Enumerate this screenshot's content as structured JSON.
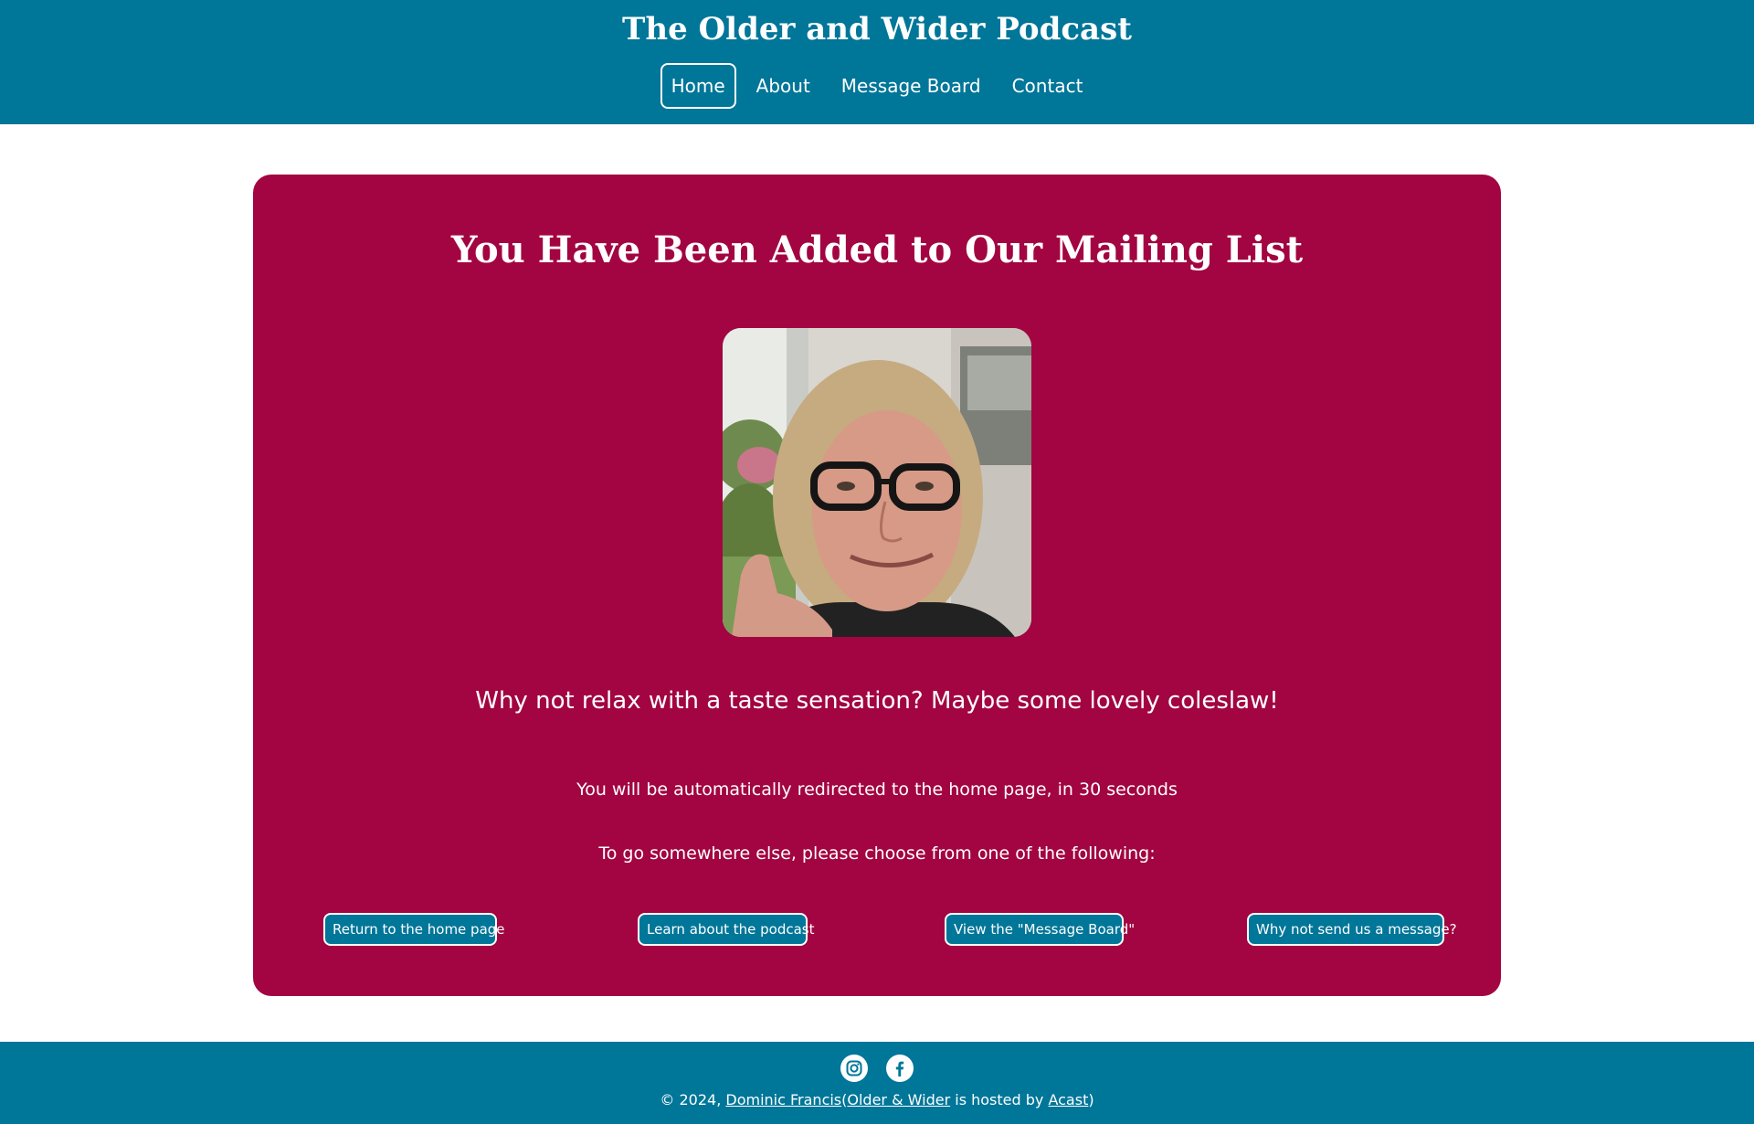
{
  "header": {
    "title": "The Older and Wider Podcast",
    "nav": [
      {
        "label": "Home",
        "active": true
      },
      {
        "label": "About"
      },
      {
        "label": "Message Board"
      },
      {
        "label": "Contact"
      }
    ]
  },
  "main": {
    "heading": "You Have Been Added to Our Mailing List",
    "tagline": "Why not relax with a taste sensation? Maybe some lovely coleslaw!",
    "redirect_text": "You will be automatically redirected to the home page, in 30 seconds",
    "choose_text": "To go somewhere else, please choose from one of the following:",
    "buttons": [
      {
        "label": "Return to the home page"
      },
      {
        "label": "Learn about the podcast"
      },
      {
        "label": "View the \"Message Board\""
      },
      {
        "label": "Why not send us a message?"
      }
    ]
  },
  "footer": {
    "icons": [
      "instagram-icon",
      "facebook-icon"
    ],
    "copyright_prefix": "© 2024,",
    "author_link": "Dominic Francis",
    "paren_open": "(",
    "site_link": "Older & Wider",
    "hosted_text": "is hosted by",
    "host_link": "Acast",
    "paren_close": ")"
  },
  "colors": {
    "header_bg": "#007699",
    "card_bg": "#a20541",
    "text": "#ffffff"
  }
}
